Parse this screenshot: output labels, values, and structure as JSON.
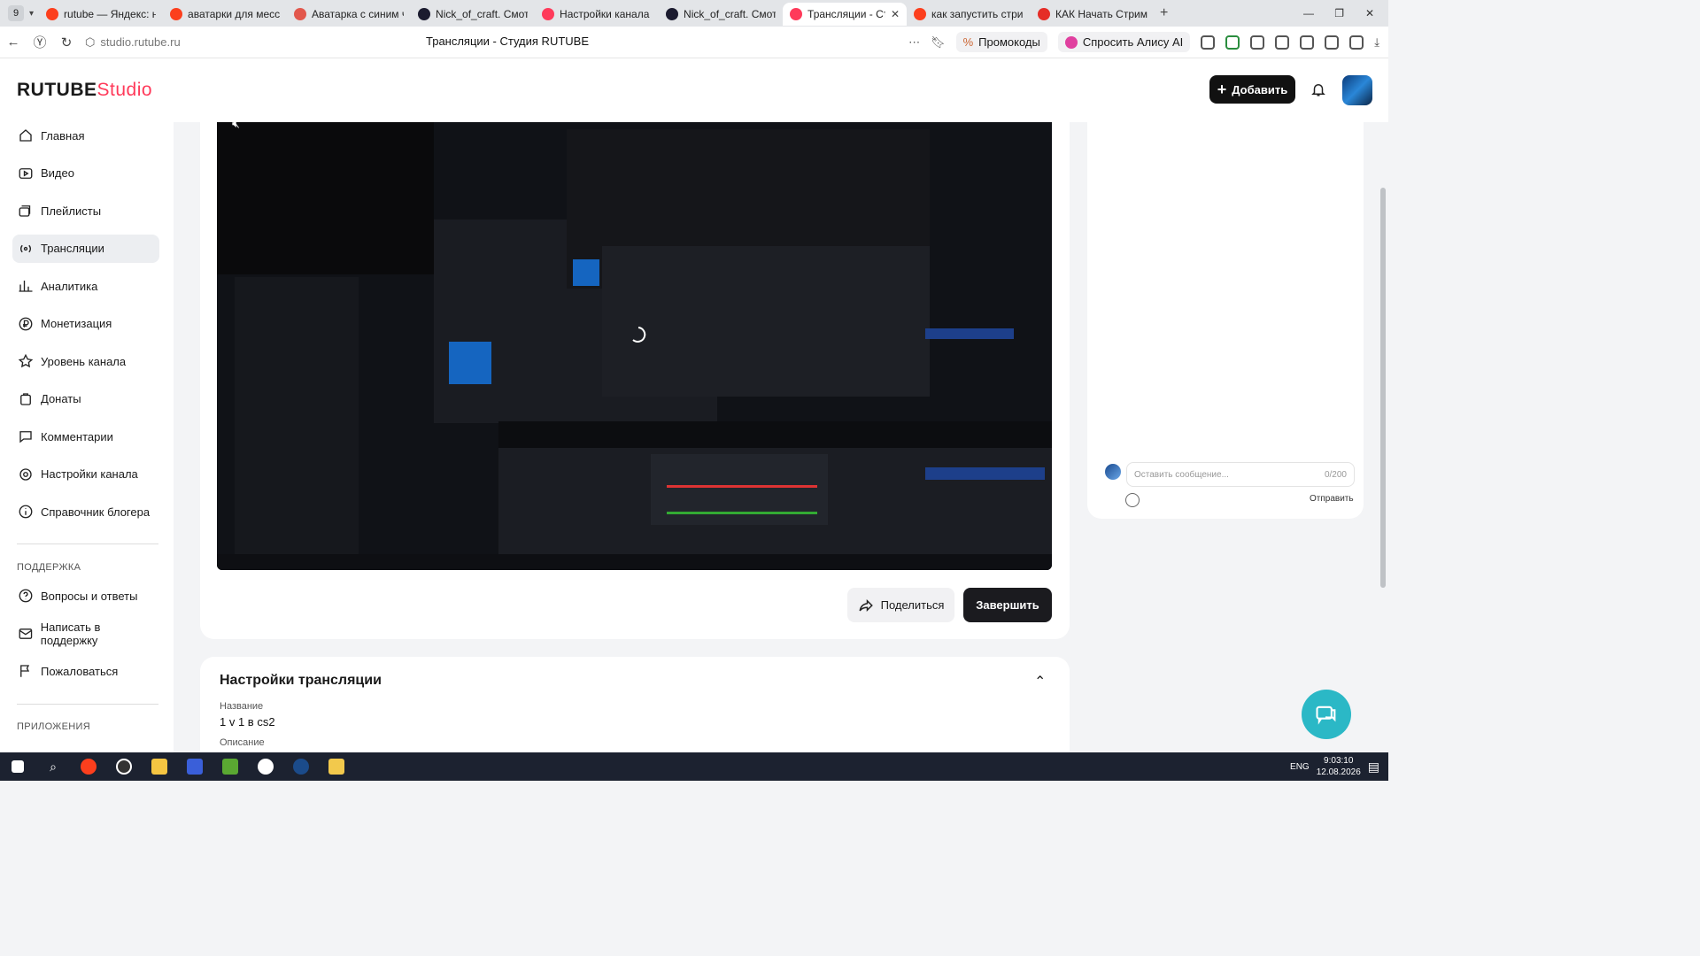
{
  "browser": {
    "tab_count": "9",
    "tabs": [
      {
        "label": "rutube — Яндекс: нашлось",
        "color": "#fc3f1d"
      },
      {
        "label": "аватарки для мессенджера",
        "color": "#fc3f1d"
      },
      {
        "label": "Аватарка с синим челове",
        "color": "#e2574c"
      },
      {
        "label": "Nick_of_craft. Смотреть",
        "color": "#1b1b2f"
      },
      {
        "label": "Настройки канала - Студ",
        "color": "#ff3a5a"
      },
      {
        "label": "Nick_of_craft. Смотреть",
        "color": "#1b1b2f"
      },
      {
        "label": "Трансляции - Студия RU",
        "color": "#ff3a5a",
        "active": true
      },
      {
        "label": "как запустить стрим на р",
        "color": "#fc3f1d"
      },
      {
        "label": "КАК Начать Стримить на",
        "color": "#e52d27"
      }
    ],
    "url": "studio.rutube.ru",
    "page_title": "Трансляции - Студия RUTUBE",
    "promo_label": "Промокоды",
    "alice_label": "Спросить Алису AI"
  },
  "header": {
    "logo_main": "RUTUBE",
    "logo_studio": "Studio",
    "add_button": "Добавить"
  },
  "sidebar": {
    "items": [
      {
        "label": "Главная",
        "icon": "home-icon"
      },
      {
        "label": "Видео",
        "icon": "video-icon"
      },
      {
        "label": "Плейлисты",
        "icon": "playlist-icon"
      },
      {
        "label": "Трансляции",
        "icon": "broadcast-icon",
        "active": true
      },
      {
        "label": "Аналитика",
        "icon": "analytics-icon"
      },
      {
        "label": "Монетизация",
        "icon": "ruble-icon"
      },
      {
        "label": "Уровень канала",
        "icon": "star-icon"
      },
      {
        "label": "Донаты",
        "icon": "donate-icon"
      },
      {
        "label": "Комментарии",
        "icon": "comment-icon"
      },
      {
        "label": "Настройки канала",
        "icon": "gear-icon"
      },
      {
        "label": "Справочник блогера",
        "icon": "info-icon"
      }
    ],
    "support_title": "ПОДДЕРЖКА",
    "support_items": [
      {
        "label": "Вопросы и ответы",
        "icon": "question-icon"
      },
      {
        "label": "Написать в поддержку",
        "icon": "mail-icon"
      },
      {
        "label": "Пожаловаться",
        "icon": "flag-icon"
      }
    ],
    "apps_title": "ПРИЛОЖЕНИЯ"
  },
  "player": {
    "share_button": "Поделиться",
    "finish_button": "Завершить"
  },
  "settings": {
    "title": "Настройки трансляции",
    "name_label": "Название",
    "name_value": "1 v 1 в cs2",
    "description_label": "Описание"
  },
  "chat": {
    "placeholder": "Оставить сообщение...",
    "counter": "0/200",
    "send_label": "Отправить"
  },
  "taskbar": {
    "lang": "ENG",
    "time": "9:03:10",
    "date": "12.08.2026"
  }
}
